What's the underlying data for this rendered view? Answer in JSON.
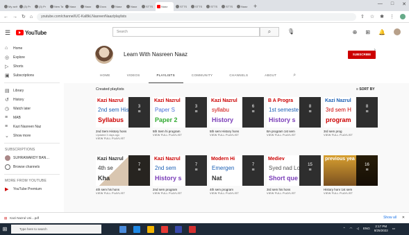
{
  "browser": {
    "tabs": [
      {
        "label": "My activ"
      },
      {
        "label": "(3) Pr"
      },
      {
        "label": "(3) Pr"
      },
      {
        "label": "New Ta"
      },
      {
        "label": "Naaz"
      },
      {
        "label": "Naaz"
      },
      {
        "label": "Docs"
      },
      {
        "label": "Naaz"
      },
      {
        "label": "Naaz"
      },
      {
        "label": "STTS"
      },
      {
        "label": "Naaz",
        "active": true
      },
      {
        "label": "STTS"
      },
      {
        "label": "STTS"
      },
      {
        "label": "STTS"
      },
      {
        "label": "STTS"
      },
      {
        "label": "Naaz"
      }
    ],
    "new_tab": "+",
    "url": "youtube.com/channel/UC-Kal8kLNasreenNaaz/playlists",
    "window_controls": {
      "minimize": "—",
      "maximize": "□",
      "close": "✕"
    }
  },
  "youtube": {
    "logo_text": "YouTube",
    "logo_superscript": "IN",
    "search_placeholder": "Search"
  },
  "sidebar": {
    "items": [
      {
        "icon": "⌂",
        "label": "Home"
      },
      {
        "icon": "◎",
        "label": "Explore"
      },
      {
        "icon": "▷",
        "label": "Shorts"
      },
      {
        "icon": "▣",
        "label": "Subscriptions"
      }
    ],
    "library": [
      {
        "icon": "▤",
        "label": "Library"
      },
      {
        "icon": "↺",
        "label": "History"
      },
      {
        "icon": "◷",
        "label": "Watch later"
      },
      {
        "icon": "≡",
        "label": "MAB"
      },
      {
        "icon": "≡",
        "label": "Kazi Nasreen Naz"
      },
      {
        "icon": "⌄",
        "label": "Show more"
      }
    ],
    "subscriptions_heading": "SUBSCRIPTIONS",
    "subscriptions": [
      {
        "label": "SUHRAWARDY BAN…"
      },
      {
        "label": "Browse channels"
      }
    ],
    "more_heading": "MORE FROM YOUTUBE",
    "more": [
      {
        "label": "YouTube Premium"
      }
    ]
  },
  "channel": {
    "name": "Learn With Nasreen Naaz",
    "subscribe_label": "SUBSCRIBE",
    "tabs": [
      "HOME",
      "VIDEOS",
      "PLAYLISTS",
      "COMMUNITY",
      "CHANNELS",
      "ABOUT"
    ],
    "active_tab": "PLAYLISTS",
    "section_title": "Created playlists",
    "sort_label": "SORT BY"
  },
  "playlists": [
    {
      "thumb_line1": "Kazi Nazrul",
      "thumb_line2": "2nd sem His",
      "thumb_line3": "Syllabus",
      "count": "3",
      "title": "2nd Sem History hons",
      "sub": "Updated 3 days ago",
      "link": "VIEW FULL PLAYLIST",
      "color1": "#c00",
      "color2": "#1a5fb4",
      "color3": "#c00"
    },
    {
      "thumb_line1": "Kazi Nazrul",
      "thumb_line2": "Paper S",
      "thumb_line3": "Paper 2",
      "count": "3",
      "title": "5th Sem hi program",
      "sub": "",
      "link": "VIEW FULL PLAYLIST",
      "color1": "#c00",
      "color2": "#4a6fd8",
      "color3": "#3a3"
    },
    {
      "thumb_line1": "Kazi Nazrul",
      "thumb_line2": "syllabu",
      "thumb_line3": "History",
      "count": "6",
      "title": "5th sem History hons",
      "sub": "",
      "link": "VIEW FULL PLAYLIST",
      "color1": "#c00",
      "color2": "#c00",
      "color3": "#7a3db8"
    },
    {
      "thumb_line1": "B A Progra",
      "thumb_line2": "1st semeste",
      "thumb_line3": "History s",
      "count": "8",
      "title": "BA program 1st sem",
      "sub": "",
      "link": "VIEW FULL PLAYLIST",
      "color1": "#c00",
      "color2": "#1a5fb4",
      "color3": "#7a3db8"
    },
    {
      "thumb_line1": "Kazi Nazrul",
      "thumb_line2": "3rd sem H",
      "thumb_line3": "program",
      "count": "8",
      "title": "3rd sem prog",
      "sub": "",
      "link": "VIEW FULL PLAYLIST",
      "color1": "#1a5fb4",
      "color2": "#c00",
      "color3": "#c00"
    },
    {
      "thumb_line1": "Kazi Nazrul",
      "thumb_line2": "4th se",
      "thumb_line3": "Kha",
      "count": "7",
      "title": "4th sem his hons",
      "sub": "",
      "link": "VIEW FULL PLAYLIST",
      "color1": "#333",
      "color2": "#333",
      "color3": "#333"
    },
    {
      "thumb_line1": "Kazi Nazrul",
      "thumb_line2": "2nd sem",
      "thumb_line3": "History s",
      "count": "7",
      "title": "2nd sem program",
      "sub": "",
      "link": "VIEW FULL PLAYLIST",
      "color1": "#c00",
      "color2": "#1a5fb4",
      "color3": "#7a3db8"
    },
    {
      "thumb_line1": "Modern Hi",
      "thumb_line2": "Emergen",
      "thumb_line3": "Nat",
      "count": "7",
      "title": "4th sem program",
      "sub": "",
      "link": "VIEW FULL PLAYLIST",
      "color1": "#c00",
      "color2": "#1a5fb4",
      "color3": "#333"
    },
    {
      "thumb_line1": "Mediev",
      "thumb_line2": "Syed nad Lo",
      "thumb_line3": "Short que",
      "count": "15",
      "title": "3rd sem his hons",
      "sub": "",
      "link": "VIEW FULL PLAYLIST",
      "color1": "#c00",
      "color2": "#555",
      "color3": "#7a3db8"
    },
    {
      "thumb_line1": "previous yea",
      "thumb_line2": "",
      "thumb_line3": "",
      "count": "16",
      "title": "History honr 1st sem",
      "sub": "",
      "link": "VIEW FULL PLAYLIST",
      "color1": "#fff",
      "color2": "#fff",
      "color3": "#fff"
    }
  ],
  "downloads": {
    "file_label": "Kazi Nazrul Uni…pdf",
    "show_all": "Show all",
    "close": "✕"
  },
  "taskbar": {
    "search_placeholder": "Type here to search",
    "time": "2:17 PM",
    "date": "8/25/2022",
    "lang": "ENG"
  }
}
